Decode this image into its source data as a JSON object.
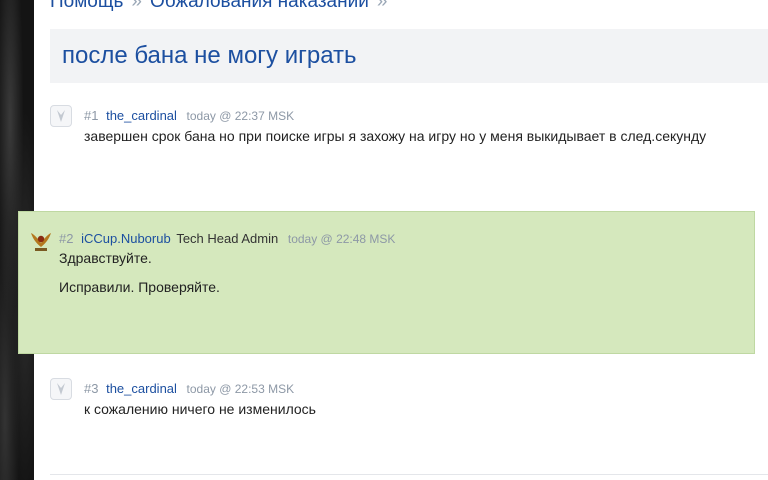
{
  "breadcrumb": {
    "items": [
      "Помощь",
      "Обжалования наказаний"
    ],
    "separator": "»"
  },
  "thread": {
    "title": "после бана не могу играть"
  },
  "posts": [
    {
      "number": "#1",
      "author": "the_cardinal",
      "role": "",
      "time": "today @ 22:37 MSK",
      "lines": [
        "завершен срок бана но при поиске игры я захожу на игру но у меня выкидывает в след.секунду"
      ]
    },
    {
      "number": "#2",
      "author": "iCCup.Nuborub",
      "role": "Tech Head Admin",
      "time": "today @ 22:48 MSK",
      "lines": [
        "Здравствуйте.",
        "Исправили. Проверяйте."
      ]
    },
    {
      "number": "#3",
      "author": "the_cardinal",
      "role": "",
      "time": "today @ 22:53 MSK",
      "lines": [
        "к сожалению ничего не изменилось"
      ]
    }
  ],
  "colors": {
    "link": "#1c4fa0",
    "admin_post_bg": "#d5e8bd",
    "title_bg": "#f2f3f5"
  }
}
